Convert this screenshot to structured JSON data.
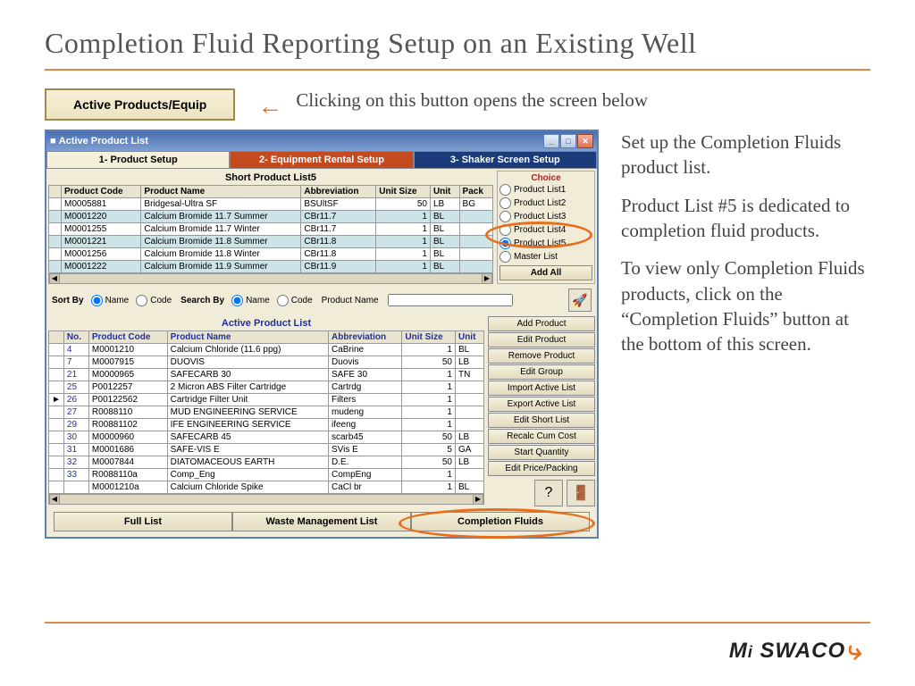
{
  "slide": {
    "title": "Completion Fluid Reporting Setup on an Existing Well",
    "ap_button": "Active Products/Equip",
    "caption": "Clicking on this button opens  the screen below",
    "side_p1": "Set up the Completion Fluids product list.",
    "side_p2": "Product List #5 is dedicated to completion fluid products.",
    "side_p3": "To view only Completion Fluids products, click on the “Completion Fluids” button at the bottom of this screen.",
    "logo": "Mi SWACO"
  },
  "window": {
    "title": "Active Product List",
    "tabs": [
      "1- Product Setup",
      "2- Equipment Rental Setup",
      "3- Shaker Screen Setup"
    ],
    "short_list_title": "Short Product List5",
    "short_cols": [
      "Product Code",
      "Product Name",
      "Abbreviation",
      "Unit Size",
      "Unit",
      "Pack"
    ],
    "short_rows": [
      {
        "sel": false,
        "code": "M0005881",
        "name": "Bridgesal-Ultra SF",
        "abbr": "BSUltSF",
        "size": "50",
        "unit": "LB",
        "pack": "BG"
      },
      {
        "sel": true,
        "code": "M0001220",
        "name": "Calcium Bromide 11.7 Summer",
        "abbr": "CBr11.7",
        "size": "1",
        "unit": "BL",
        "pack": ""
      },
      {
        "sel": false,
        "code": "M0001255",
        "name": "Calcium Bromide 11.7 Winter",
        "abbr": "CBr11.7",
        "size": "1",
        "unit": "BL",
        "pack": ""
      },
      {
        "sel": true,
        "code": "M0001221",
        "name": "Calcium Bromide 11.8 Summer",
        "abbr": "CBr11.8",
        "size": "1",
        "unit": "BL",
        "pack": ""
      },
      {
        "sel": false,
        "code": "M0001256",
        "name": "Calcium Bromide 11.8 Winter",
        "abbr": "CBr11.8",
        "size": "1",
        "unit": "BL",
        "pack": ""
      },
      {
        "sel": true,
        "code": "M0001222",
        "name": "Calcium Bromide 11.9 Summer",
        "abbr": "CBr11.9",
        "size": "1",
        "unit": "BL",
        "pack": ""
      }
    ],
    "choice": {
      "title": "Choice",
      "options": [
        "Product List1",
        "Product List2",
        "Product List3",
        "Product List4",
        "Product List5",
        "Master List"
      ],
      "selected_index": 4,
      "add_all": "Add All"
    },
    "sort_by_label": "Sort By",
    "search_by_label": "Search By",
    "name_label": "Name",
    "code_label": "Code",
    "product_name_label": "Product Name",
    "apl_title": "Active Product List",
    "apl_cols": [
      "No.",
      "Product Code",
      "Product Name",
      "Abbreviation",
      "Unit Size",
      "Unit"
    ],
    "apl_rows": [
      {
        "cur": false,
        "no": "4",
        "code": "M0001210",
        "name": "Calcium Chloride (11.6 ppg)",
        "abbr": "CaBrine",
        "size": "1",
        "unit": "BL"
      },
      {
        "cur": false,
        "no": "7",
        "code": "M0007915",
        "name": "DUOVIS",
        "abbr": "Duovis",
        "size": "50",
        "unit": "LB"
      },
      {
        "cur": false,
        "no": "21",
        "code": "M0000965",
        "name": "SAFECARB 30",
        "abbr": "SAFE 30",
        "size": "1",
        "unit": "TN"
      },
      {
        "cur": false,
        "no": "25",
        "code": "P0012257",
        "name": "2 Micron ABS Filter Cartridge",
        "abbr": "Cartrdg",
        "size": "1",
        "unit": ""
      },
      {
        "cur": true,
        "no": "26",
        "code": "P00122562",
        "name": "Cartridge Filter Unit",
        "abbr": "Filters",
        "size": "1",
        "unit": ""
      },
      {
        "cur": false,
        "no": "27",
        "code": "R0088110",
        "name": "MUD ENGINEERING SERVICE",
        "abbr": "mudeng",
        "size": "1",
        "unit": ""
      },
      {
        "cur": false,
        "no": "29",
        "code": "R00881102",
        "name": "IFE ENGINEERING SERVICE",
        "abbr": "ifeeng",
        "size": "1",
        "unit": ""
      },
      {
        "cur": false,
        "no": "30",
        "code": "M0000960",
        "name": "SAFECARB 45",
        "abbr": "scarb45",
        "size": "50",
        "unit": "LB"
      },
      {
        "cur": false,
        "no": "31",
        "code": "M0001686",
        "name": "SAFE-VIS E",
        "abbr": "SVis E",
        "size": "5",
        "unit": "GA"
      },
      {
        "cur": false,
        "no": "32",
        "code": "M0007844",
        "name": "DIATOMACEOUS EARTH",
        "abbr": "D.E.",
        "size": "50",
        "unit": "LB"
      },
      {
        "cur": false,
        "no": "33",
        "code": "R0088110a",
        "name": "Comp_Eng",
        "abbr": "CompEng",
        "size": "1",
        "unit": ""
      },
      {
        "cur": false,
        "no": "",
        "code": "M0001210a",
        "name": "Calcium Chloride Spike",
        "abbr": "CaCl br",
        "size": "1",
        "unit": "BL"
      }
    ],
    "side_btns": [
      "Add Product",
      "Edit Product",
      "Remove Product",
      "Edit Group",
      "Import Active List",
      "Export Active List",
      "Edit Short List",
      "Recalc Cum Cost",
      "Start Quantity",
      "Edit Price/Packing"
    ],
    "bottom_tabs": [
      "Full List",
      "Waste Management List",
      "Completion Fluids"
    ]
  }
}
